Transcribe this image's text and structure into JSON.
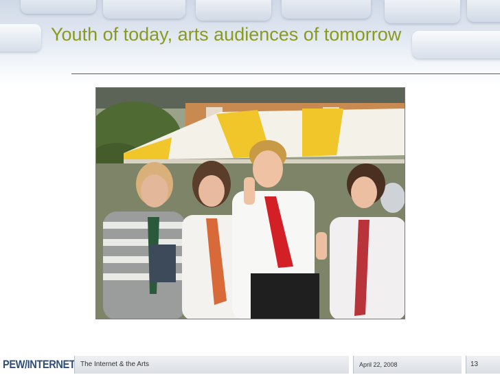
{
  "slide": {
    "title": "Youth of today, arts audiences of tomorrow"
  },
  "footer": {
    "logo_text": "PEW/INTERNET",
    "presentation_title": "The Internet & the Arts",
    "date": "April 22, 2008",
    "page_number": "13"
  },
  "colors": {
    "title": "#8a9a1e",
    "logo": "#2f4d7a",
    "background_top": "#cfd8e6"
  }
}
